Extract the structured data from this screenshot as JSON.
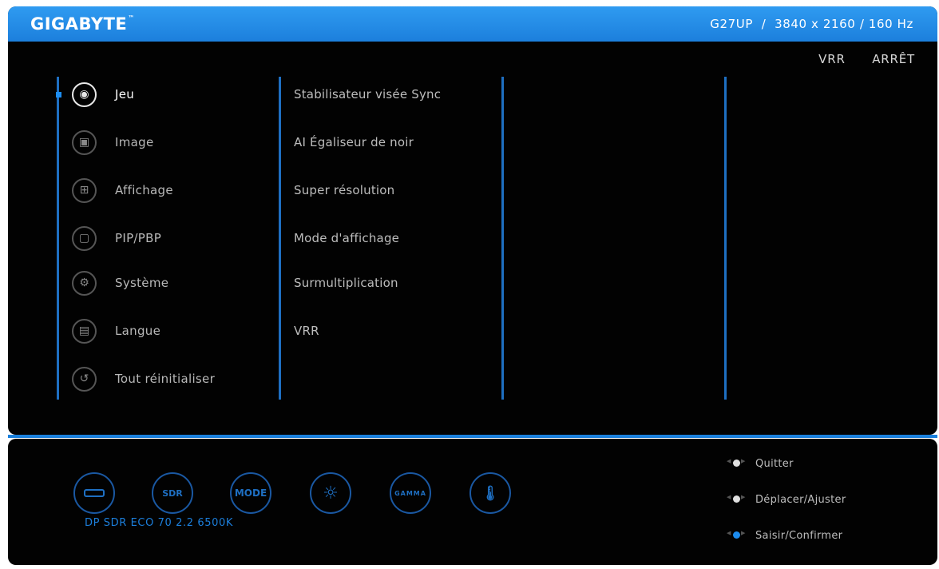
{
  "header": {
    "brand": "GIGABYTE",
    "model_info": "G27UP  /  3840 x 2160 / 160 Hz"
  },
  "status": {
    "label": "VRR",
    "value": "ARRÊT"
  },
  "main_menu": [
    {
      "label": "Jeu",
      "icon": "gamepad-icon",
      "selected": true
    },
    {
      "label": "Image",
      "icon": "picture-icon",
      "selected": false
    },
    {
      "label": "Affichage",
      "icon": "display-grid-icon",
      "selected": false
    },
    {
      "label": "PIP/PBP",
      "icon": "pip-icon",
      "selected": false
    },
    {
      "label": "Système",
      "icon": "gear-icon",
      "selected": false
    },
    {
      "label": "Langue",
      "icon": "language-icon",
      "selected": false
    },
    {
      "label": "Tout réinitialiser",
      "icon": "reset-icon",
      "selected": false
    }
  ],
  "sub_menu": [
    "Stabilisateur visée Sync",
    "AI Égaliseur de noir",
    "Super résolution",
    "Mode d'affichage",
    "Surmultiplication",
    "VRR"
  ],
  "quick_icons": [
    {
      "icon": "input-port-icon",
      "text": ""
    },
    {
      "icon": "sdr-icon",
      "text": "SDR"
    },
    {
      "icon": "mode-icon",
      "text": "MODE"
    },
    {
      "icon": "brightness-icon",
      "text": "☼"
    },
    {
      "icon": "gamma-icon",
      "text": "GAMMA"
    },
    {
      "icon": "thermometer-icon",
      "text": "🌡"
    }
  ],
  "quick_status": "DP SDR ECO 70 2.2 6500K",
  "legend": [
    {
      "label": "Quitter",
      "icon": "joystick-left-icon"
    },
    {
      "label": "Déplacer/Ajuster",
      "icon": "joystick-move-icon"
    },
    {
      "label": "Saisir/Confirmer",
      "icon": "joystick-press-icon"
    }
  ],
  "colors": {
    "accent": "#1c7fdc",
    "background": "#020202",
    "text": "#bdbdbd"
  }
}
